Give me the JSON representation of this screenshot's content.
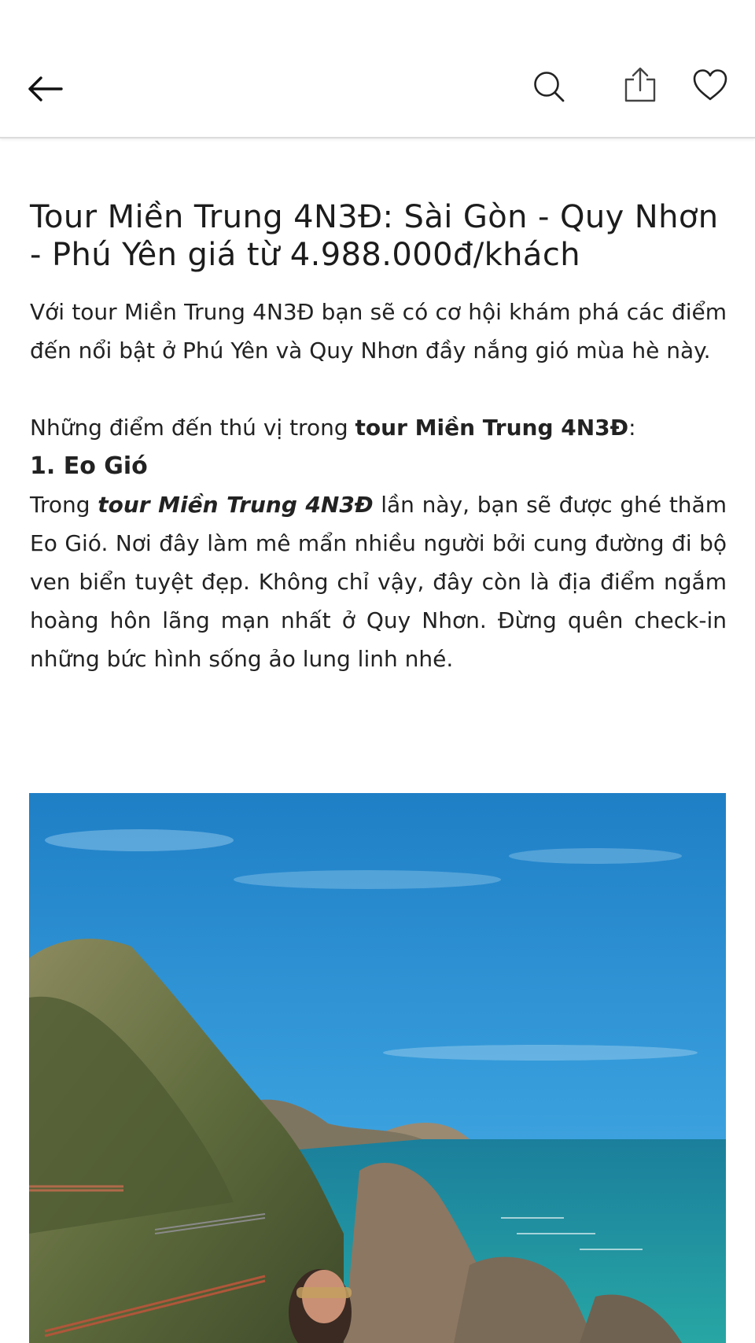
{
  "header": {
    "back_icon": "arrow-left-icon",
    "search_icon": "search-icon",
    "share_icon": "share-icon",
    "favorite_icon": "heart-icon"
  },
  "article": {
    "title": "Tour Miền Trung 4N3Đ: Sài Gòn - Quy Nhơn - Phú Yên giá từ 4.988.000đ/khách",
    "intro": "Với tour Miền Trung 4N3Đ bạn sẽ có cơ hội khám phá các điểm đến nổi bật ở Phú Yên và Quy Nhơn đầy nắng gió mùa hè này.",
    "highlights_prefix": "Những điểm đến thú vị trong ",
    "highlights_bold": "tour Miền Trung 4N3Đ",
    "highlights_suffix": ":",
    "section1_heading": "1. Eo Gió",
    "section1_prefix": "Trong ",
    "section1_emph": "tour Miền Trung 4N3Đ",
    "section1_body": " lần này, bạn sẽ được ghé thăm Eo Gió. Nơi đây làm mê mẩn nhiều người bởi cung đường đi bộ ven biển tuyệt đẹp. Không chỉ vậy, đây còn là địa điểm ngắm hoàng hôn lãng mạn nhất ở Quy Nhơn. Đừng quên check-in những bức hình sống ảo lung linh nhé."
  },
  "colors": {
    "sky": "#2a8fd0",
    "sea": "#1f9aa6",
    "rock": "#8a7a66"
  }
}
